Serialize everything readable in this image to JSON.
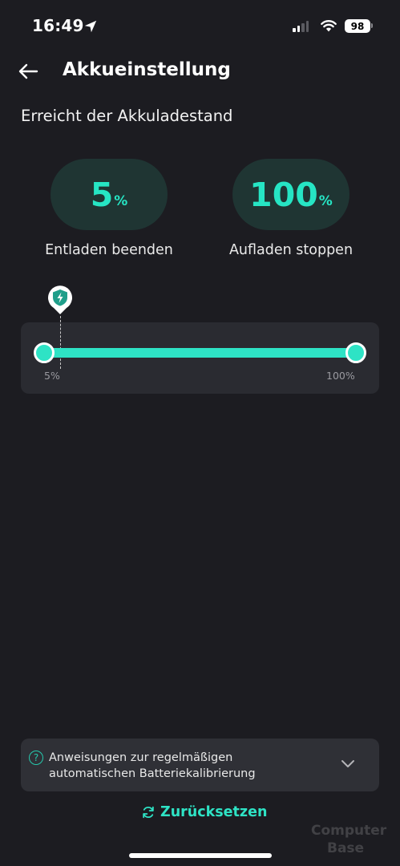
{
  "status_bar": {
    "time": "16:49",
    "battery_level": "98",
    "signal_bars_active": 2,
    "signal_bars_total": 4
  },
  "header": {
    "title": "Akkueinstellung"
  },
  "section": {
    "title": "Erreicht der Akkuladestand"
  },
  "discharge": {
    "value": "5",
    "unit": "%",
    "label": "Entladen beenden"
  },
  "charge": {
    "value": "100",
    "unit": "%",
    "label": "Aufladen stoppen"
  },
  "slider": {
    "min_label": "5%",
    "max_label": "100%",
    "lower_value": 5,
    "upper_value": 100
  },
  "instructions": {
    "line1": "Anweisungen zur regelmäßigen",
    "line2": "automatischen Batteriekalibrierung"
  },
  "reset": {
    "label": "Zurücksetzen"
  },
  "watermark": {
    "line1": "Computer",
    "line2": "Base"
  },
  "colors": {
    "accent": "#2ee3c5",
    "background": "#1c1c21",
    "pill": "#1f3533",
    "card": "#2a2b31"
  },
  "icons": [
    "location-arrow-icon",
    "signal-icon",
    "wifi-icon",
    "battery-icon",
    "back-arrow-icon",
    "shield-bolt-icon",
    "help-icon",
    "chevron-down-icon",
    "refresh-icon"
  ]
}
